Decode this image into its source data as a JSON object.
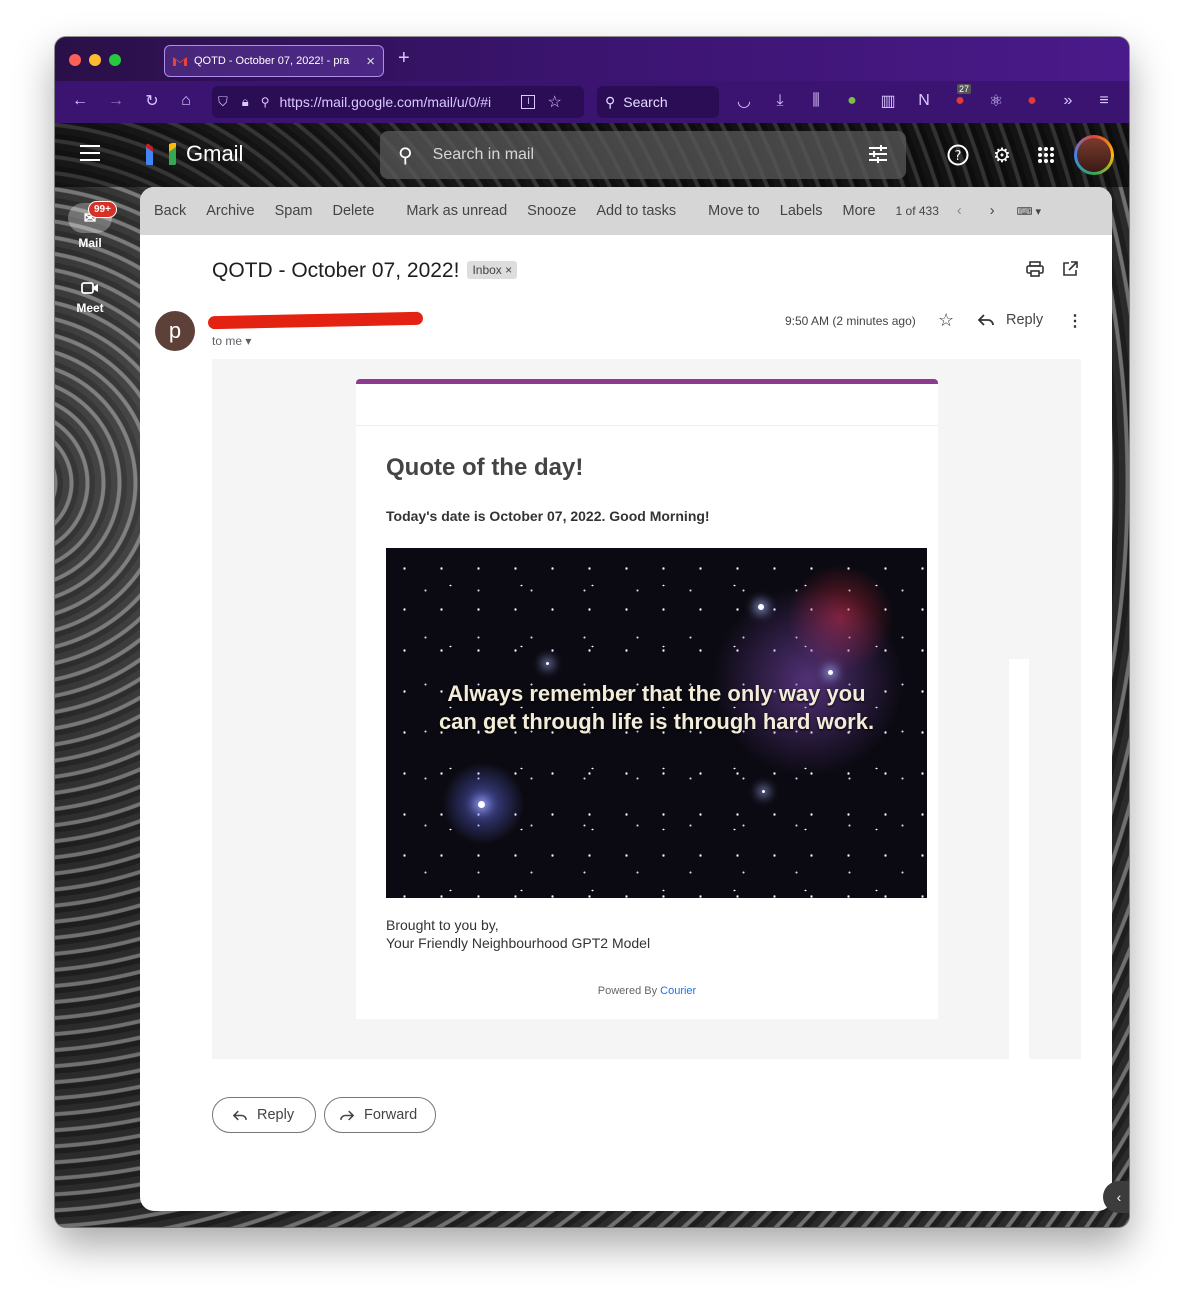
{
  "browser": {
    "tab_title": "QOTD - October 07, 2022! - pra",
    "url": "https://mail.google.com/mail/u/0/#i",
    "search_label": "Search",
    "extension_badge": "27"
  },
  "gmail": {
    "brand": "Gmail",
    "search_placeholder": "Search in mail",
    "rail": {
      "mail_label": "Mail",
      "mail_badge": "99+",
      "meet_label": "Meet"
    },
    "actions": [
      "Back",
      "Archive",
      "Spam",
      "Delete",
      "Mark as unread",
      "Snooze",
      "Add to tasks",
      "Move to",
      "Labels",
      "More"
    ],
    "pagination": "1 of 433"
  },
  "email": {
    "subject": "QOTD - October 07, 2022!",
    "label_chip": "Inbox",
    "sender_initial": "p",
    "recipient": "to me",
    "time": "9:50 AM (2 minutes ago)",
    "reply_label": "Reply",
    "card": {
      "heading": "Quote of the day!",
      "date_line": "Today's date is October 07, 2022. Good Morning!",
      "quote": "Always remember that the only way you can get through life is through hard work.",
      "credit_line1": "Brought to you by,",
      "credit_line2": "Your Friendly Neighbourhood GPT2 Model",
      "powered_by": "Powered By",
      "powered_brand": "Courier"
    },
    "footer": {
      "reply": "Reply",
      "forward": "Forward"
    }
  },
  "colors": {
    "accent_bar": "#8e3a8e",
    "badge_red": "#d93025",
    "link_blue": "#1a73e8",
    "titlebar_purple": "#3a1470"
  }
}
